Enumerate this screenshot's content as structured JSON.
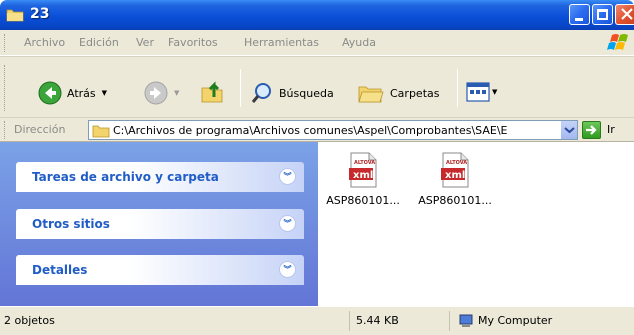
{
  "window": {
    "title": "23",
    "icon": "folder-icon"
  },
  "menu": {
    "items": [
      "Archivo",
      "Edición",
      "Ver",
      "Favoritos",
      "Herramientas",
      "Ayuda"
    ]
  },
  "toolbar": {
    "back_label": "Atrás",
    "search_label": "Búsqueda",
    "folders_label": "Carpetas"
  },
  "address": {
    "label": "Dirección",
    "path": "C:\\Archivos de programa\\Archivos comunes\\Aspel\\Comprobantes\\SAE\\E",
    "go_label": "Ir"
  },
  "taskpane": {
    "sections": [
      {
        "title": "Tareas de archivo y carpeta"
      },
      {
        "title": "Otros sitios"
      },
      {
        "title": "Detalles"
      }
    ]
  },
  "files": [
    {
      "name": "ASP860101...",
      "icon_text": "xml",
      "brand": "ALTOVA"
    },
    {
      "name": "ASP860101...",
      "icon_text": "xml",
      "brand": "ALTOVA"
    }
  ],
  "status": {
    "count": "2 objetos",
    "size": "5.44 KB",
    "location": "My Computer"
  },
  "colors": {
    "titlebar": "#0a4fd8",
    "taskpane_top": "#7ba2e7",
    "taskpane_bottom": "#6375d6",
    "task_title": "#215dc6",
    "chrome": "#ece9d8"
  }
}
